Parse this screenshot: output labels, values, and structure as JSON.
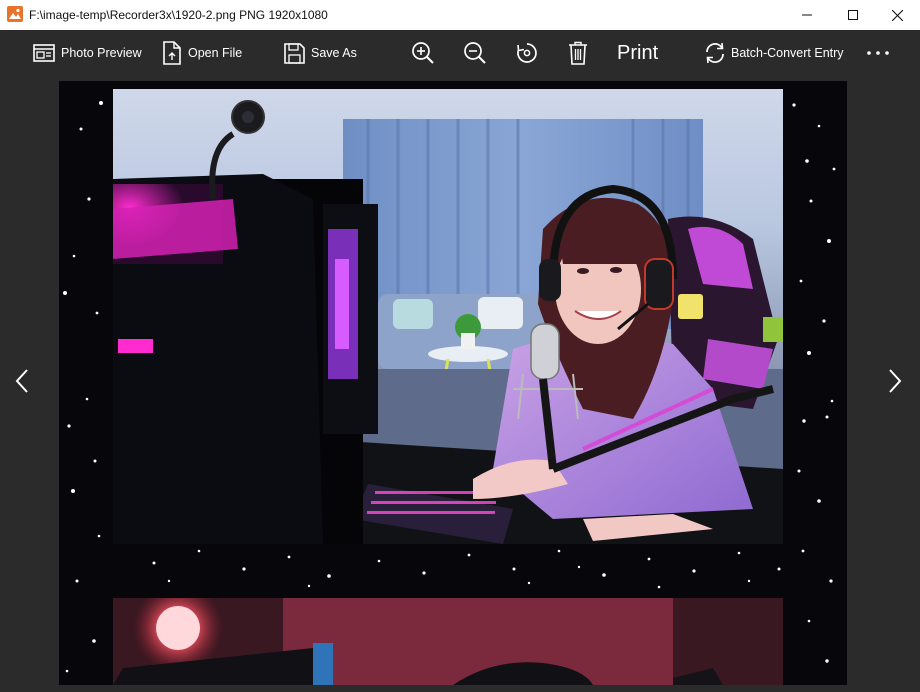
{
  "window": {
    "title": "F:\\image-temp\\Recorder3x\\1920-2.png PNG 1920x1080",
    "icon": "photo-app-icon",
    "controls": [
      "minimize-icon",
      "maximize-icon",
      "close-icon"
    ]
  },
  "toolbar": {
    "photo_preview_label": "Photo Preview",
    "open_file_label": "Open File",
    "save_as_label": "Save As",
    "print_label": "Print",
    "batch_convert_label": "Batch-Convert Entry",
    "icons": [
      "photo-preview-icon",
      "open-file-icon",
      "save-icon",
      "zoom-in-icon",
      "zoom-out-icon",
      "rotate-icon",
      "delete-icon",
      "refresh-icon",
      "more-icon"
    ]
  },
  "viewer": {
    "prev_icon": "chevron-left-icon",
    "next_icon": "chevron-right-icon",
    "background_color": "#2b2b2b",
    "canvas_color": "#07070b"
  },
  "colors": {
    "app_icon_orange": "#e8742c",
    "toolbar_bg": "#2b2b2b",
    "text": "#ffffff"
  }
}
